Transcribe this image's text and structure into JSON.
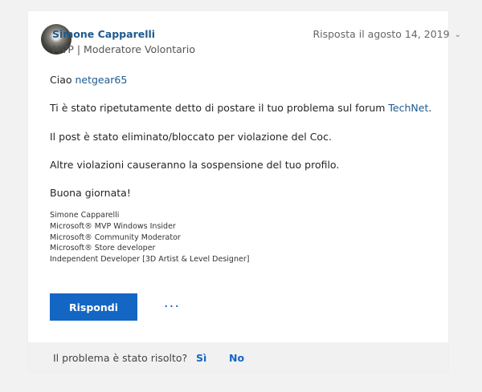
{
  "post": {
    "author": {
      "name": "Simone Capparelli",
      "role": "MVP | Moderatore Volontario"
    },
    "reply_date": "Risposta il agosto 14, 2019",
    "greeting_prefix": "Ciao ",
    "greeting_user": "netgear65",
    "paragraph1_prefix": "Ti è stato ripetutamente detto di postare il tuo problema sul forum ",
    "paragraph1_link": "TechNet",
    "paragraph1_suffix": ".",
    "paragraph2": "Il post è stato eliminato/bloccato per violazione del Coc.",
    "paragraph3": "Altre violazioni causeranno la sospensione del tuo profilo.",
    "closing": "Buona giornata!",
    "signature": [
      "Simone Capparelli",
      "Microsoft® MVP Windows Insider",
      "Microsoft® Community Moderator",
      "Microsoft® Store developer",
      "Independent Developer [3D Artist & Level Designer]"
    ]
  },
  "actions": {
    "reply_label": "Rispondi",
    "more_label": "···"
  },
  "footer": {
    "question": "Il problema è stato risolto?",
    "yes_label": "Sì",
    "no_label": "No"
  },
  "icons": {
    "chevron": "chevron-down-icon"
  }
}
